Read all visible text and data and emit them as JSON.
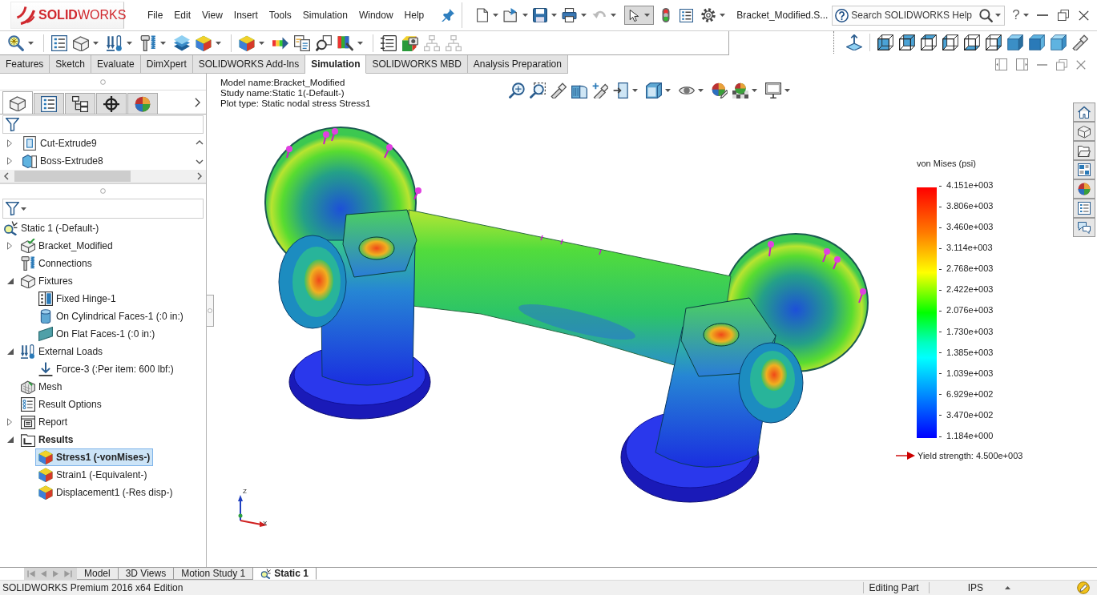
{
  "app": {
    "logo": "**SOLID**WORKS",
    "menu": [
      "File",
      "Edit",
      "View",
      "Insert",
      "Tools",
      "Simulation",
      "Window",
      "Help"
    ],
    "document_title": "Bracket_Modified.S...",
    "search": {
      "placeholder": "Search SOLIDWORKS Help"
    },
    "help_button": "?"
  },
  "command_tabs": [
    {
      "label": "Features",
      "selected": false
    },
    {
      "label": "Sketch",
      "selected": false
    },
    {
      "label": "Evaluate",
      "selected": false
    },
    {
      "label": "DimXpert",
      "selected": false
    },
    {
      "label": "SOLIDWORKS Add-Ins",
      "selected": false
    },
    {
      "label": "Simulation",
      "selected": true
    },
    {
      "label": "SOLIDWORKS MBD",
      "selected": false
    },
    {
      "label": "Analysis Preparation",
      "selected": false
    }
  ],
  "manager_tabs": [
    {
      "selected": true
    },
    {
      "selected": false
    },
    {
      "selected": false
    },
    {
      "selected": false
    },
    {
      "selected": false
    }
  ],
  "feature_tree": [
    {
      "kind": "cut",
      "label": "Cut-Extrude9",
      "expanded": false,
      "selected": false
    },
    {
      "kind": "boss",
      "label": "Boss-Extrude8",
      "expanded": false,
      "selected": false
    }
  ],
  "simulation_tree": {
    "kind": "study",
    "label": "Static 1 (-Default-)",
    "selected": false,
    "active": false,
    "children": [
      {
        "kind": "part",
        "label": "Bracket_Modified",
        "expanded": false,
        "selected": false,
        "active": false
      },
      {
        "kind": "connections",
        "label": "Connections",
        "selected": false,
        "active": false
      },
      {
        "kind": "fixtures",
        "label": "Fixtures",
        "expanded": true,
        "selected": false,
        "active": false,
        "children": [
          {
            "kind": "hinge",
            "label": "Fixed Hinge-1",
            "selected": false,
            "active": false
          },
          {
            "kind": "cylinder",
            "label": "On Cylindrical Faces-1 (:0 in:)",
            "selected": false,
            "active": false
          },
          {
            "kind": "flat",
            "label": "On Flat Faces-1 (:0 in:)",
            "selected": false,
            "active": false
          }
        ]
      },
      {
        "kind": "loads",
        "label": "External Loads",
        "expanded": true,
        "selected": false,
        "active": false,
        "children": [
          {
            "kind": "force",
            "label": "Force-3 (:Per item: 600 lbf:)",
            "selected": false,
            "active": false
          }
        ]
      },
      {
        "kind": "mesh",
        "label": "Mesh",
        "selected": false,
        "active": false
      },
      {
        "kind": "options",
        "label": "Result Options",
        "selected": false,
        "active": false
      },
      {
        "kind": "report",
        "label": "Report",
        "expanded": false,
        "selected": false,
        "active": false
      },
      {
        "kind": "results",
        "label": "Results",
        "expanded": true,
        "selected": false,
        "active": true,
        "children": [
          {
            "kind": "stress",
            "label": "Stress1 (-vonMises-)",
            "selected": true,
            "active": true
          },
          {
            "kind": "strain",
            "label": "Strain1 (-Equivalent-)",
            "selected": false,
            "active": false
          },
          {
            "kind": "displacement",
            "label": "Displacement1 (-Res disp-)",
            "selected": false,
            "active": false
          }
        ]
      }
    ]
  },
  "viewport": {
    "plot_info": [
      "Model name:Bracket_Modified",
      "Study name:Static 1(-Default-)",
      "Plot type: Static nodal stress Stress1"
    ],
    "legend": {
      "title": "von Mises (psi)",
      "labels": [
        "4.151e+003",
        "3.806e+003",
        "3.460e+003",
        "3.114e+003",
        "2.768e+003",
        "2.422e+003",
        "2.076e+003",
        "1.730e+003",
        "1.385e+003",
        "1.039e+003",
        "6.929e+002",
        "3.470e+002",
        "1.184e+000"
      ],
      "yield_strength": "Yield strength: 4.500e+003"
    },
    "triad": {
      "z_label": "Z",
      "x_label": "X"
    }
  },
  "bottom_tabs": [
    {
      "kind": "model",
      "label": "Model",
      "selected": false
    },
    {
      "kind": "views",
      "label": "3D Views",
      "selected": false
    },
    {
      "kind": "motion",
      "label": "Motion Study 1",
      "selected": false
    },
    {
      "kind": "study",
      "label": "Static 1",
      "selected": true
    }
  ],
  "status_bar": {
    "edition": "SOLIDWORKS Premium 2016 x64 Edition",
    "mode": "Editing Part",
    "units": "IPS"
  }
}
